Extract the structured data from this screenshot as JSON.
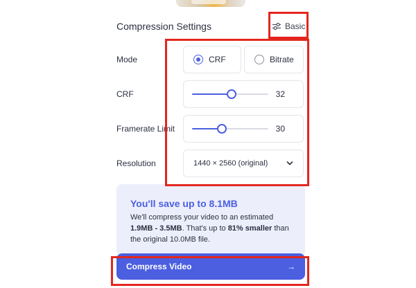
{
  "settings": {
    "title": "Compression Settings",
    "mode_toggle_label": "Basic"
  },
  "mode": {
    "label": "Mode",
    "options": [
      "CRF",
      "Bitrate"
    ],
    "selected": "CRF"
  },
  "crf": {
    "label": "CRF",
    "value": "32",
    "fraction": 0.52
  },
  "framerate": {
    "label": "Framerate Limit",
    "value": "30",
    "fraction": 0.39
  },
  "resolution": {
    "label": "Resolution",
    "selected": "1440 × 2560 (original)"
  },
  "savings": {
    "headline": "You'll save up to 8.1MB",
    "line1": "We'll compress your video to an estimated",
    "range": "1.9MB - 3.5MB",
    "mid": ". That's up to ",
    "percent": "81% smaller",
    "after": " than",
    "line3": "the original 10.0MB file."
  },
  "cta": {
    "label": "Compress Video",
    "arrow": "→"
  },
  "colors": {
    "accent": "#4b5fe0",
    "highlight": "#e3261d",
    "panel": "#eceefc"
  },
  "icons": [
    "sliders-icon",
    "chevron-down-icon",
    "arrow-right-icon"
  ]
}
